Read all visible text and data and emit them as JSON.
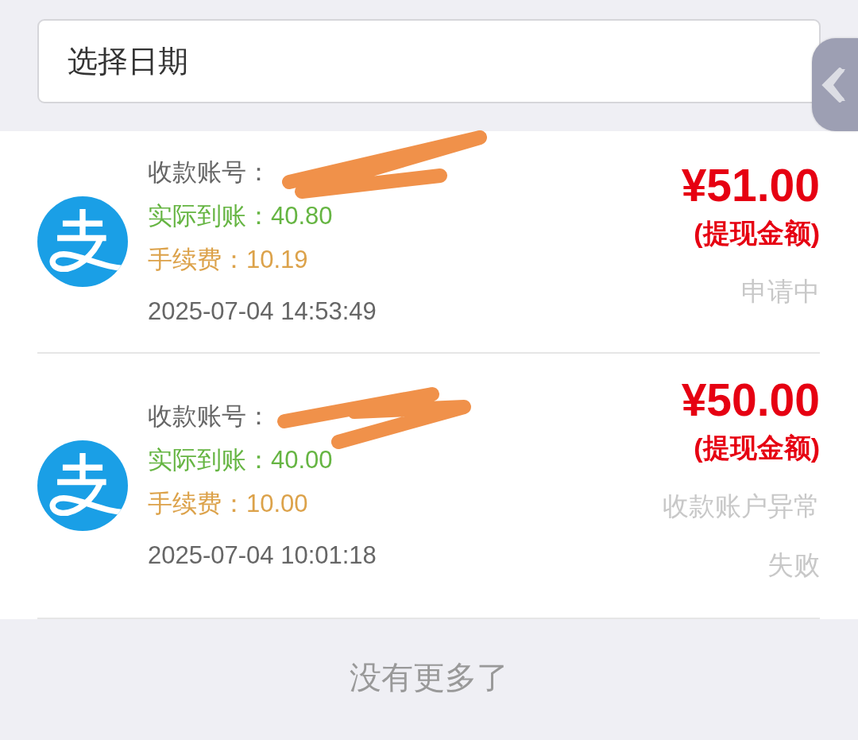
{
  "date_filter": {
    "placeholder": "选择日期"
  },
  "records": [
    {
      "account_label": "收款账号：",
      "account_redacted": true,
      "received": "实际到账：40.80",
      "fee": "手续费：10.19",
      "time": "2025-07-04 14:53:49",
      "amount": "¥51.00",
      "amount_label": "(提现金额)",
      "status": [
        "申请中"
      ]
    },
    {
      "account_label": "收款账号：",
      "account_redacted": true,
      "received": "实际到账：40.00",
      "fee": "手续费：10.00",
      "time": "2025-07-04 10:01:18",
      "amount": "¥50.00",
      "amount_label": "(提现金额)",
      "status": [
        "收款账户异常",
        "失败"
      ]
    }
  ],
  "footer": "没有更多了"
}
